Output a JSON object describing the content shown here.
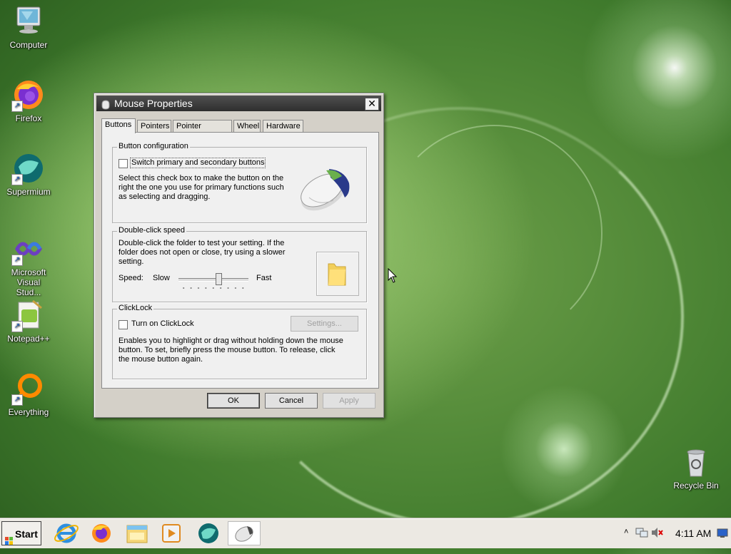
{
  "desktop": {
    "icons": [
      {
        "label": "Computer",
        "icon": "computer-icon"
      },
      {
        "label": "Firefox",
        "icon": "firefox-icon"
      },
      {
        "label": "Supermium",
        "icon": "supermium-icon"
      },
      {
        "label": "Microsoft Visual Stud...",
        "icon": "visual-studio-icon"
      },
      {
        "label": "Notepad++",
        "icon": "notepadpp-icon"
      },
      {
        "label": "Everything",
        "icon": "everything-icon"
      },
      {
        "label": "Recycle Bin",
        "icon": "recycle-bin-icon"
      }
    ]
  },
  "dialog": {
    "title": "Mouse Properties",
    "close": "✕",
    "tabs": [
      "Buttons",
      "Pointers",
      "Pointer Options",
      "Wheel",
      "Hardware"
    ],
    "active_tab": "Buttons",
    "button_config": {
      "label": "Button configuration",
      "checkbox_label": "Switch primary and secondary buttons",
      "checked": false,
      "description": "Select this check box to make the button on the right the one you use for primary functions such as selecting and dragging."
    },
    "double_click": {
      "label": "Double-click speed",
      "description": "Double-click the folder to test your setting. If the folder does not open or close, try using a slower setting.",
      "speed_label": "Speed:",
      "slow_label": "Slow",
      "fast_label": "Fast",
      "slider_value": 0.6
    },
    "clicklock": {
      "label": "ClickLock",
      "checkbox_label": "Turn on ClickLock",
      "checked": false,
      "settings_button": "Settings...",
      "description": "Enables you to highlight or drag without holding down the mouse button. To set, briefly press the mouse button. To release, click the mouse button again."
    },
    "buttons": {
      "ok": "OK",
      "cancel": "Cancel",
      "apply": "Apply"
    }
  },
  "taskbar": {
    "start_label": "Start",
    "apps": [
      "internet-explorer-icon",
      "firefox-icon",
      "file-explorer-icon",
      "media-player-icon",
      "supermium-icon",
      "mouse-properties-icon"
    ],
    "clock": "4:11 AM"
  }
}
